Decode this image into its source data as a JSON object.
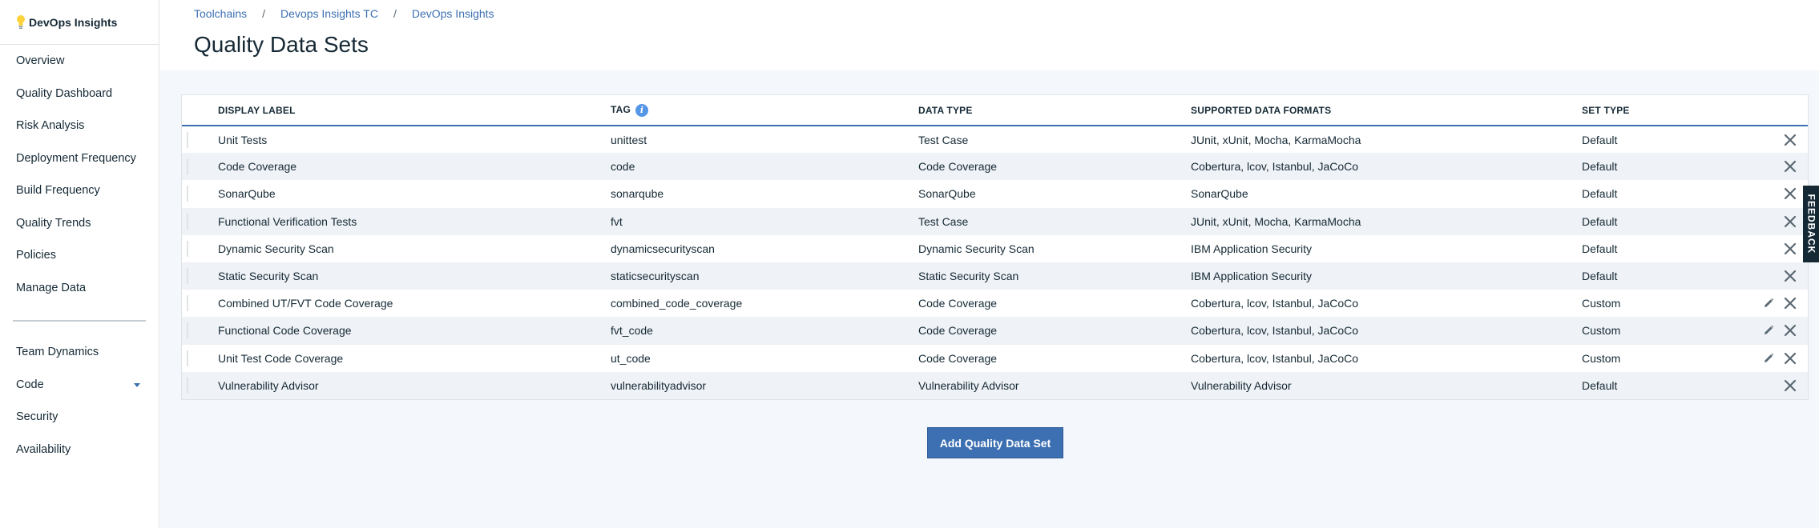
{
  "brand": {
    "name": "DevOps Insights",
    "icon": "lightbulb-icon"
  },
  "sidebar": {
    "primary": [
      {
        "label": "Overview"
      },
      {
        "label": "Quality Dashboard"
      },
      {
        "label": "Risk Analysis"
      },
      {
        "label": "Deployment Frequency"
      },
      {
        "label": "Build Frequency"
      },
      {
        "label": "Quality Trends"
      },
      {
        "label": "Policies"
      },
      {
        "label": "Manage Data"
      }
    ],
    "secondary": [
      {
        "label": "Team Dynamics"
      },
      {
        "label": "Code",
        "has_submenu": true
      },
      {
        "label": "Security"
      },
      {
        "label": "Availability"
      }
    ]
  },
  "breadcrumb": [
    "Toolchains",
    "Devops Insights TC",
    "DevOps Insights"
  ],
  "breadcrumb_separator": "/",
  "page_title": "Quality Data Sets",
  "table": {
    "columns": [
      "DISPLAY LABEL",
      "TAG",
      "DATA TYPE",
      "SUPPORTED DATA FORMATS",
      "SET TYPE"
    ],
    "rows": [
      {
        "label": "Unit Tests",
        "tag": "unittest",
        "type": "Test Case",
        "formats": "JUnit, xUnit, Mocha, KarmaMocha",
        "set": "Default",
        "editable": false
      },
      {
        "label": "Code Coverage",
        "tag": "code",
        "type": "Code Coverage",
        "formats": "Cobertura, lcov, Istanbul, JaCoCo",
        "set": "Default",
        "editable": false
      },
      {
        "label": "SonarQube",
        "tag": "sonarqube",
        "type": "SonarQube",
        "formats": "SonarQube",
        "set": "Default",
        "editable": false
      },
      {
        "label": "Functional Verification Tests",
        "tag": "fvt",
        "type": "Test Case",
        "formats": "JUnit, xUnit, Mocha, KarmaMocha",
        "set": "Default",
        "editable": false
      },
      {
        "label": "Dynamic Security Scan",
        "tag": "dynamicsecurityscan",
        "type": "Dynamic Security Scan",
        "formats": "IBM Application Security",
        "set": "Default",
        "editable": false
      },
      {
        "label": "Static Security Scan",
        "tag": "staticsecurityscan",
        "type": "Static Security Scan",
        "formats": "IBM Application Security",
        "set": "Default",
        "editable": false
      },
      {
        "label": "Combined UT/FVT Code Coverage",
        "tag": "combined_code_coverage",
        "type": "Code Coverage",
        "formats": "Cobertura, lcov, Istanbul, JaCoCo",
        "set": "Custom",
        "editable": true
      },
      {
        "label": "Functional Code Coverage",
        "tag": "fvt_code",
        "type": "Code Coverage",
        "formats": "Cobertura, lcov, Istanbul, JaCoCo",
        "set": "Custom",
        "editable": true
      },
      {
        "label": "Unit Test Code Coverage",
        "tag": "ut_code",
        "type": "Code Coverage",
        "formats": "Cobertura, lcov, Istanbul, JaCoCo",
        "set": "Custom",
        "editable": true
      },
      {
        "label": "Vulnerability Advisor",
        "tag": "vulnerabilityadvisor",
        "type": "Vulnerability Advisor",
        "formats": "Vulnerability Advisor",
        "set": "Default",
        "editable": false
      }
    ]
  },
  "add_button_label": "Add Quality Data Set",
  "feedback_label": "FEEDBACK",
  "colors": {
    "accent": "#3d70b2",
    "info": "#5596e6",
    "text": "#152935",
    "stripe": "#eff2f6"
  }
}
